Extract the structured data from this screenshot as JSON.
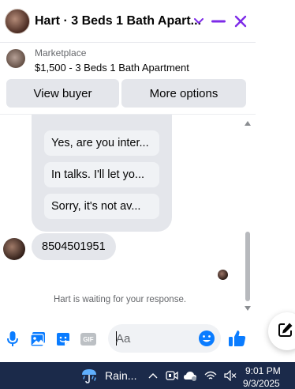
{
  "header": {
    "title": "Hart · 3 Beds 1 Bath Apart...",
    "accent": "#7d2ae8"
  },
  "marketplace": {
    "label": "Marketplace",
    "listing": "$1,500 - 3 Beds 1 Bath Apartment",
    "view_buyer": "View buyer",
    "more_options": "More options"
  },
  "messages": {
    "quick_replies": [
      "Yes, are you inter...",
      "In talks. I'll let yo...",
      "Sorry, it's not av..."
    ],
    "phone": "8504501951",
    "waiting": "Hart is waiting for your response."
  },
  "composer": {
    "placeholder": "Aa",
    "accent": "#0a7cff"
  },
  "taskbar": {
    "weather": "Rain...",
    "time": "9:01 PM",
    "date": "9/3/2025",
    "background": "#1b2a4a"
  }
}
